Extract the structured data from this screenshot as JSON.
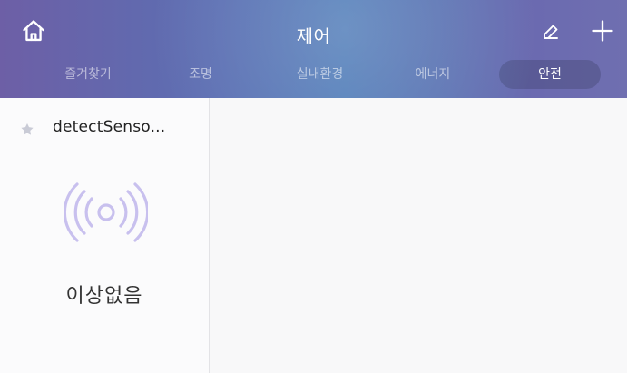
{
  "header": {
    "title": "제어",
    "gradient_colors": [
      "#6d5fa6",
      "#4d7ab7",
      "#6f6fb0"
    ],
    "icons": {
      "home": "home-icon",
      "edit": "pencil-icon",
      "add": "plus-icon"
    }
  },
  "tabs": [
    {
      "label": "즐겨찾기",
      "selected": false
    },
    {
      "label": "조명",
      "selected": false
    },
    {
      "label": "실내환경",
      "selected": false
    },
    {
      "label": "에너지",
      "selected": false
    },
    {
      "label": "안전",
      "selected": true
    }
  ],
  "device": {
    "name": "detectSenso...",
    "favorite_icon": "star-icon",
    "sensor_icon": "radio-waves-icon",
    "status": "이상없음",
    "accent_color": "#c8c0ee"
  }
}
